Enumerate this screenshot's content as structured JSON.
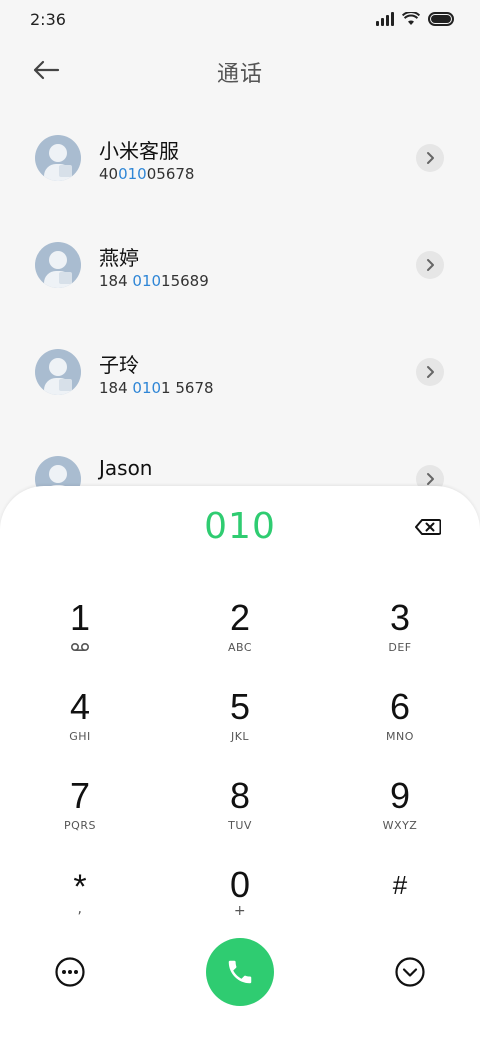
{
  "status_bar": {
    "time": "2:36"
  },
  "header": {
    "title": "通话"
  },
  "contacts": [
    {
      "name": "小米客服",
      "number_parts": [
        "40",
        "010",
        "05678"
      ]
    },
    {
      "name": "燕婷",
      "number_parts": [
        "184 ",
        "010",
        "15689"
      ]
    },
    {
      "name": "子玲",
      "number_parts": [
        "184 ",
        "010",
        "1 5678"
      ]
    },
    {
      "name": "Jason",
      "number_parts": [
        "",
        "",
        ""
      ]
    }
  ],
  "dialpad": {
    "input_value": "010",
    "keys": [
      {
        "digit": "1",
        "letters": ""
      },
      {
        "digit": "2",
        "letters": "ABC"
      },
      {
        "digit": "3",
        "letters": "DEF"
      },
      {
        "digit": "4",
        "letters": "GHI"
      },
      {
        "digit": "5",
        "letters": "JKL"
      },
      {
        "digit": "6",
        "letters": "MNO"
      },
      {
        "digit": "7",
        "letters": "PQRS"
      },
      {
        "digit": "8",
        "letters": "TUV"
      },
      {
        "digit": "9",
        "letters": "WXYZ"
      },
      {
        "digit": "*",
        "letters": ","
      },
      {
        "digit": "0",
        "letters": "+"
      },
      {
        "digit": "#",
        "letters": ""
      }
    ]
  },
  "colors": {
    "accent_green": "#2fcc71",
    "highlight_blue": "#2f86d6",
    "avatar_bg": "#a9bcd0"
  },
  "icons": {
    "back": "arrow-left-icon",
    "detail": "chevron-right-icon",
    "backspace": "backspace-icon",
    "voicemail": "voicemail-icon",
    "more": "more-icon",
    "call": "phone-icon",
    "collapse": "chevron-down-icon"
  }
}
